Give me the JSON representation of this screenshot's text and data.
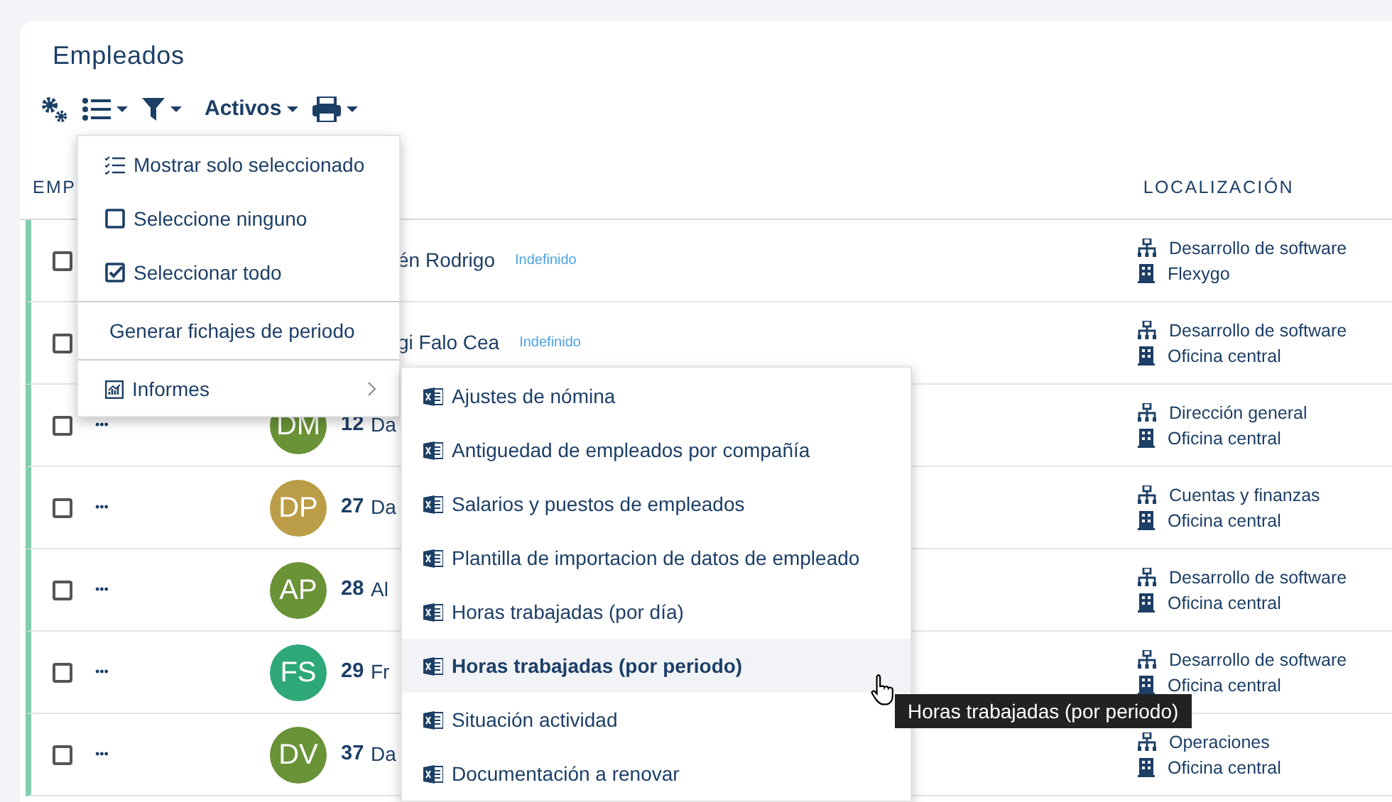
{
  "title": "Empleados",
  "toolbar": [
    {
      "kind": "settings"
    },
    {
      "kind": "list",
      "caret": true
    },
    {
      "kind": "filter",
      "caret": true
    },
    {
      "kind": "text",
      "label": "Activos",
      "caret": true
    },
    {
      "kind": "print",
      "caret": true
    }
  ],
  "table": {
    "columns": [
      "EMP",
      "LOCALIZACIÓN"
    ],
    "rows": [
      {
        "checked": false,
        "name": "én Rodrigo",
        "contract": "Indefinido",
        "department": "Desarrollo de software",
        "site": "Flexygo"
      },
      {
        "checked": false,
        "name": "gi Falo Cea",
        "contract": "Indefinido",
        "department": "Desarrollo de software",
        "site": "Oficina central"
      },
      {
        "checked": false,
        "more": "•••",
        "initials": "DM",
        "color": "#6a9236",
        "number": "12",
        "name": "Da",
        "department": "Dirección general",
        "site": "Oficina central"
      },
      {
        "checked": false,
        "more": "•••",
        "initials": "DP",
        "color": "#bb9d47",
        "number": "27",
        "name": "Da",
        "department": "Cuentas y finanzas",
        "site": "Oficina central"
      },
      {
        "checked": false,
        "more": "•••",
        "initials": "AP",
        "color": "#6a9236",
        "number": "28",
        "name": "Al",
        "department": "Desarrollo de software",
        "site": "Oficina central"
      },
      {
        "checked": false,
        "more": "•••",
        "initials": "FS",
        "color": "#2ea879",
        "number": "29",
        "name": "Fr",
        "department": "Desarrollo de software",
        "site": "Oficina central"
      },
      {
        "checked": false,
        "more": "•••",
        "initials": "DV",
        "color": "#6a9236",
        "number": "37",
        "name": "Da",
        "department": "Operaciones",
        "site": "Oficina central"
      }
    ]
  },
  "menu": [
    {
      "kind": "show-selected",
      "label": "Mostrar solo seleccionado"
    },
    {
      "kind": "select-none",
      "label": "Seleccione ninguno"
    },
    {
      "kind": "select-all",
      "label": "Seleccionar todo"
    },
    {
      "kind": "action",
      "label": "Generar fichajes de periodo"
    },
    {
      "kind": "submenu",
      "label": "Informes"
    }
  ],
  "submenu": [
    {
      "label": "Ajustes de nómina",
      "selected": false
    },
    {
      "label": "Antiguedad de empleados por compañía",
      "selected": false
    },
    {
      "label": "Salarios y puestos de empleados",
      "selected": false
    },
    {
      "label": "Plantilla de importacion de datos de empleado",
      "selected": false
    },
    {
      "label": "Horas trabajadas (por día)",
      "selected": false
    },
    {
      "label": "Horas trabajadas (por periodo)",
      "selected": true
    },
    {
      "label": "Situación actividad",
      "selected": false
    },
    {
      "label": "Documentación a renovar",
      "selected": false
    }
  ],
  "tooltip": "Horas trabajadas (por periodo)"
}
